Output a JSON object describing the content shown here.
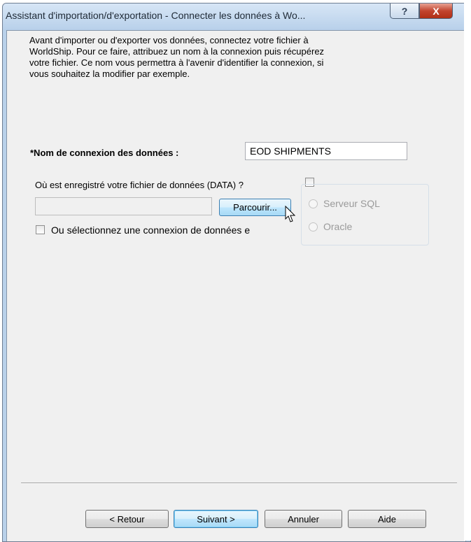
{
  "window": {
    "title": "Assistant d'importation/d'exportation - Connecter les données à Wo...",
    "help_symbol": "?",
    "close_symbol": "X"
  },
  "intro_text": "Avant d'importer ou d'exporter vos données, connectez votre fichier à WorldShip. Pour ce faire, attribuez un nom à la connexion puis récupérez votre fichier. Ce nom vous permettra à l'avenir d'identifier la connexion, si vous souhaitez la modifier par exemple.",
  "connection": {
    "label": "*Nom de connexion des données :",
    "value": "EOD SHIPMENTS"
  },
  "data_file": {
    "label": "Où est enregistré votre fichier de données (DATA) ?",
    "path_value": "",
    "browse_label": "Parcourir..."
  },
  "database_options": {
    "sql_server_label": "Serveur SQL",
    "oracle_label": "Oracle"
  },
  "or_select_label": "Ou sélectionnez une connexion de données e",
  "footer": {
    "back_label": "< Retour",
    "next_label": "Suivant >",
    "cancel_label": "Annuler",
    "help_label": "Aide"
  }
}
